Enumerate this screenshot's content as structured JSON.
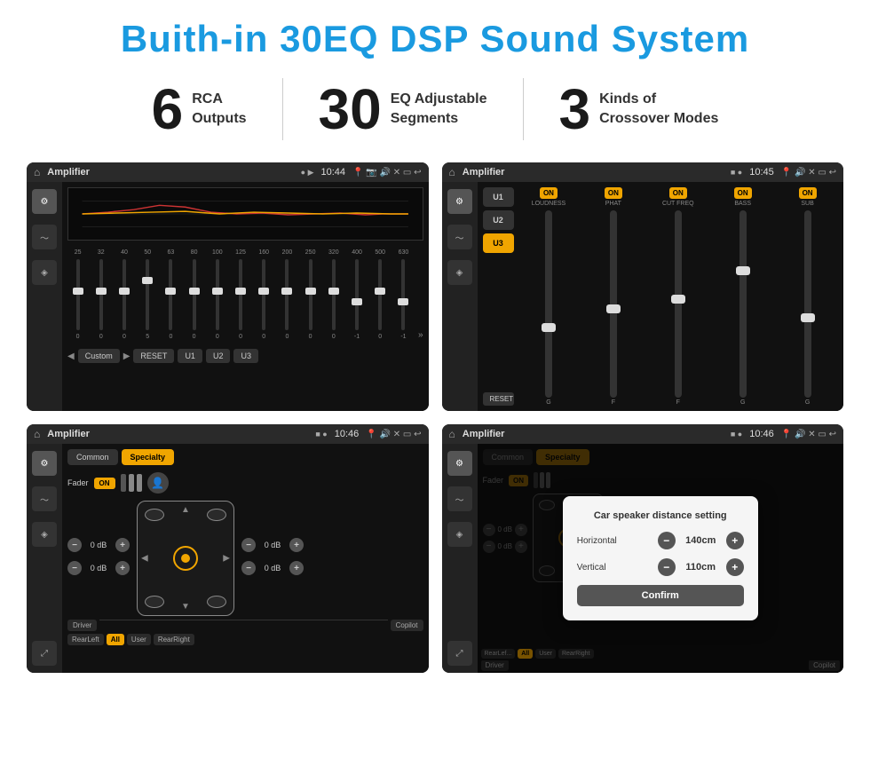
{
  "header": {
    "title": "Buith-in 30EQ DSP Sound System"
  },
  "stats": [
    {
      "number": "6",
      "text_line1": "RCA",
      "text_line2": "Outputs"
    },
    {
      "number": "30",
      "text_line1": "EQ Adjustable",
      "text_line2": "Segments"
    },
    {
      "number": "3",
      "text_line1": "Kinds of",
      "text_line2": "Crossover Modes"
    }
  ],
  "screens": [
    {
      "id": "screen1",
      "status_bar": {
        "title": "Amplifier",
        "time": "10:44",
        "icons": "📍 📷 🔊 ✕ ▭ ↩"
      },
      "eq_freqs": [
        "25",
        "32",
        "40",
        "50",
        "63",
        "80",
        "100",
        "125",
        "160",
        "200",
        "250",
        "320",
        "400",
        "500",
        "630"
      ],
      "eq_values": [
        "0",
        "0",
        "0",
        "5",
        "0",
        "0",
        "0",
        "0",
        "0",
        "0",
        "0",
        "0",
        "-1",
        "0",
        "-1"
      ],
      "eq_preset": "Custom",
      "eq_buttons": [
        "RESET",
        "U1",
        "U2",
        "U3"
      ]
    },
    {
      "id": "screen2",
      "status_bar": {
        "title": "Amplifier",
        "time": "10:45"
      },
      "presets": [
        "U1",
        "U2",
        "U3"
      ],
      "channels": [
        {
          "name": "LOUDNESS",
          "on": true
        },
        {
          "name": "PHAT",
          "on": true
        },
        {
          "name": "CUT FREQ",
          "on": true
        },
        {
          "name": "BASS",
          "on": true
        },
        {
          "name": "SUB",
          "on": true
        }
      ],
      "reset_label": "RESET"
    },
    {
      "id": "screen3",
      "status_bar": {
        "title": "Amplifier",
        "time": "10:46"
      },
      "tabs": [
        "Common",
        "Specialty"
      ],
      "active_tab": 1,
      "fader_label": "Fader",
      "fader_on": "ON",
      "zones": [
        {
          "label": "0 dB"
        },
        {
          "label": "0 dB"
        },
        {
          "label": "0 dB"
        },
        {
          "label": "0 dB"
        }
      ],
      "buttons": [
        "Driver",
        "Copilot",
        "RearLeft",
        "All",
        "User",
        "RearRight"
      ]
    },
    {
      "id": "screen4",
      "status_bar": {
        "title": "Amplifier",
        "time": "10:46"
      },
      "tabs": [
        "Common",
        "Specialty"
      ],
      "dialog": {
        "title": "Car speaker distance setting",
        "horizontal_label": "Horizontal",
        "horizontal_value": "140cm",
        "vertical_label": "Vertical",
        "vertical_value": "110cm",
        "confirm_label": "Confirm"
      },
      "zone_values": [
        "0 dB",
        "0 dB"
      ],
      "buttons": [
        "Driver",
        "Copilot",
        "RearLeft",
        "All",
        "User",
        "RearRight"
      ]
    }
  ],
  "colors": {
    "accent_blue": "#1a9ae0",
    "accent_orange": "#f0a500",
    "bg_dark": "#111111",
    "bg_darker": "#0a0a0a",
    "text_light": "#cccccc",
    "text_dim": "#888888"
  }
}
